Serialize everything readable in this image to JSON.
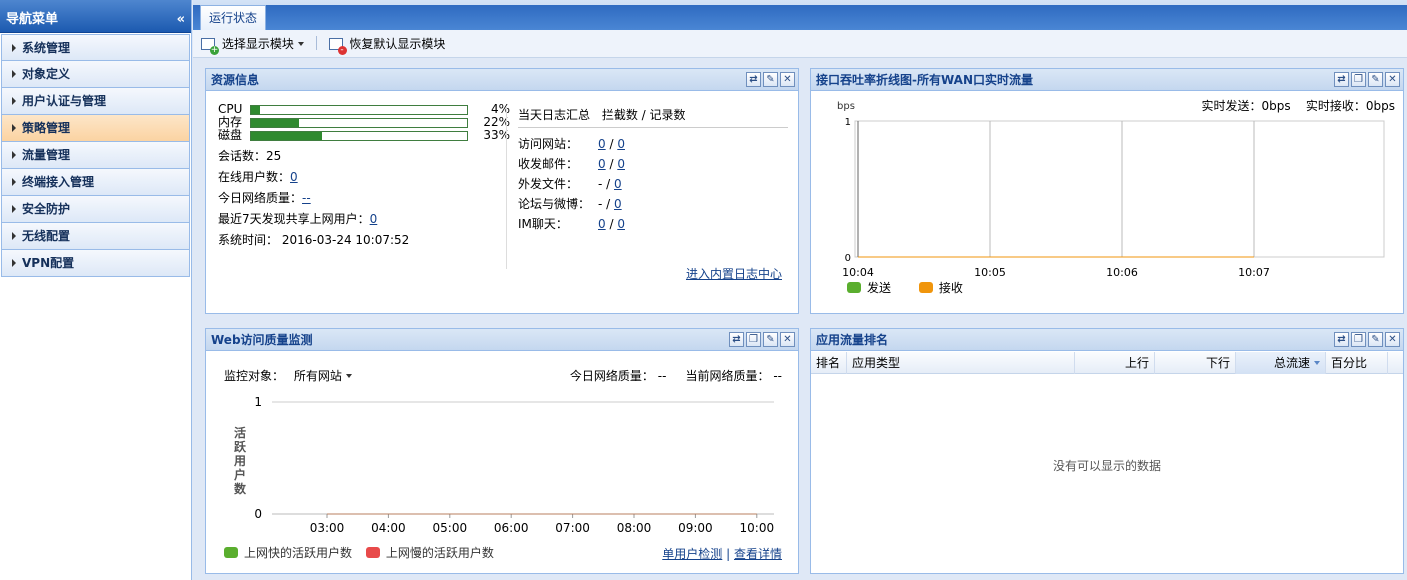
{
  "sidebar": {
    "title": "导航菜单",
    "collapse_glyph": "«",
    "items": [
      {
        "label": "系统管理"
      },
      {
        "label": "对象定义"
      },
      {
        "label": "用户认证与管理"
      },
      {
        "label": "策略管理",
        "active": true
      },
      {
        "label": "流量管理"
      },
      {
        "label": "终端接入管理"
      },
      {
        "label": "安全防护"
      },
      {
        "label": "无线配置"
      },
      {
        "label": "VPN配置"
      }
    ]
  },
  "tabs": [
    {
      "label": "运行状态"
    }
  ],
  "toolbar": {
    "select_modules": "选择显示模块",
    "restore_default": "恢复默认显示模块"
  },
  "resource": {
    "title": "资源信息",
    "bars": [
      {
        "label": "CPU",
        "pct_text": "4%",
        "value": 0.04
      },
      {
        "label": "内存",
        "pct_text": "22%",
        "value": 0.22
      },
      {
        "label": "磁盘",
        "pct_text": "33%",
        "value": 0.33
      }
    ],
    "sessions_label": "会话数：",
    "sessions_value": "25",
    "online_label": "在线用户数：",
    "online_value": "0",
    "quality_label": "今日网络质量：",
    "quality_value": "--",
    "shared_label": "最近7天发现共享上网用户：",
    "shared_value": "0",
    "time_label": "系统时间：",
    "time_value": "2016-03-24 10:07:52",
    "log_title": "当天日志汇总",
    "log_columns": "拦截数 / 记录数",
    "logs": [
      {
        "label": "访问网站：",
        "blocked": "0",
        "total": "0",
        "blocked_link": true
      },
      {
        "label": "收发邮件：",
        "blocked": "0",
        "total": "0",
        "blocked_link": true
      },
      {
        "label": "外发文件：",
        "blocked": "-",
        "total": "0",
        "blocked_link": false
      },
      {
        "label": "论坛与微博：",
        "blocked": "-",
        "total": "0",
        "blocked_link": false
      },
      {
        "label": "IM聊天：",
        "blocked": "0",
        "total": "0",
        "blocked_link": true
      }
    ],
    "log_center_link": "进入内置日志中心"
  },
  "throughput": {
    "title": "接口吞吐率折线图-所有WAN口实时流量",
    "send_label": "实时发送：",
    "send_value": "0bps",
    "recv_label": "实时接收：",
    "recv_value": "0bps",
    "unit": "bps",
    "legend_send": "发送",
    "legend_recv": "接收",
    "colors": {
      "send": "#5aae2e",
      "recv": "#f0950c"
    }
  },
  "webquality": {
    "title": "Web访问质量监测",
    "target_label": "监控对象：",
    "target_value": "所有网站",
    "today_label": "今日网络质量：",
    "today_value": "--",
    "current_label": "当前网络质量：",
    "current_value": "--",
    "ylabel": "活跃用户数",
    "legend_fast": "上网快的活跃用户数",
    "legend_slow": "上网慢的活跃用户数",
    "link_single": "单用户检测",
    "link_sep": "|",
    "link_detail": "查看详情",
    "colors": {
      "fast": "#5aae2e",
      "slow": "#e84a4a"
    }
  },
  "apprank": {
    "title": "应用流量排名",
    "columns": [
      "排名",
      "应用类型",
      "上行",
      "下行",
      "总流速",
      "百分比"
    ],
    "empty_text": "没有可以显示的数据"
  },
  "chart_data": [
    {
      "type": "line",
      "title": "接口吞吐率折线图-所有WAN口实时流量",
      "ylabel": "bps",
      "x": [
        "10:04",
        "10:05",
        "10:06",
        "10:07"
      ],
      "ylim": [
        0,
        1
      ],
      "yticks": [
        0,
        1
      ],
      "series": [
        {
          "name": "发送",
          "values": [
            0,
            0,
            0,
            0
          ]
        },
        {
          "name": "接收",
          "values": [
            0,
            0,
            0,
            0
          ]
        }
      ],
      "legend": "bottom-left",
      "grid": true
    },
    {
      "type": "line",
      "title": "Web访问质量监测",
      "ylabel": "活跃用户数",
      "x": [
        "03:00",
        "04:00",
        "05:00",
        "06:00",
        "07:00",
        "08:00",
        "09:00",
        "10:00"
      ],
      "ylim": [
        0,
        1
      ],
      "yticks": [
        0,
        1
      ],
      "series": [
        {
          "name": "上网快的活跃用户数",
          "values": [
            0,
            0,
            0,
            0,
            0,
            0,
            0,
            0
          ]
        },
        {
          "name": "上网慢的活跃用户数",
          "values": [
            0,
            0,
            0,
            0,
            0,
            0,
            0,
            0
          ]
        }
      ],
      "legend": "bottom-left",
      "grid": true
    }
  ]
}
